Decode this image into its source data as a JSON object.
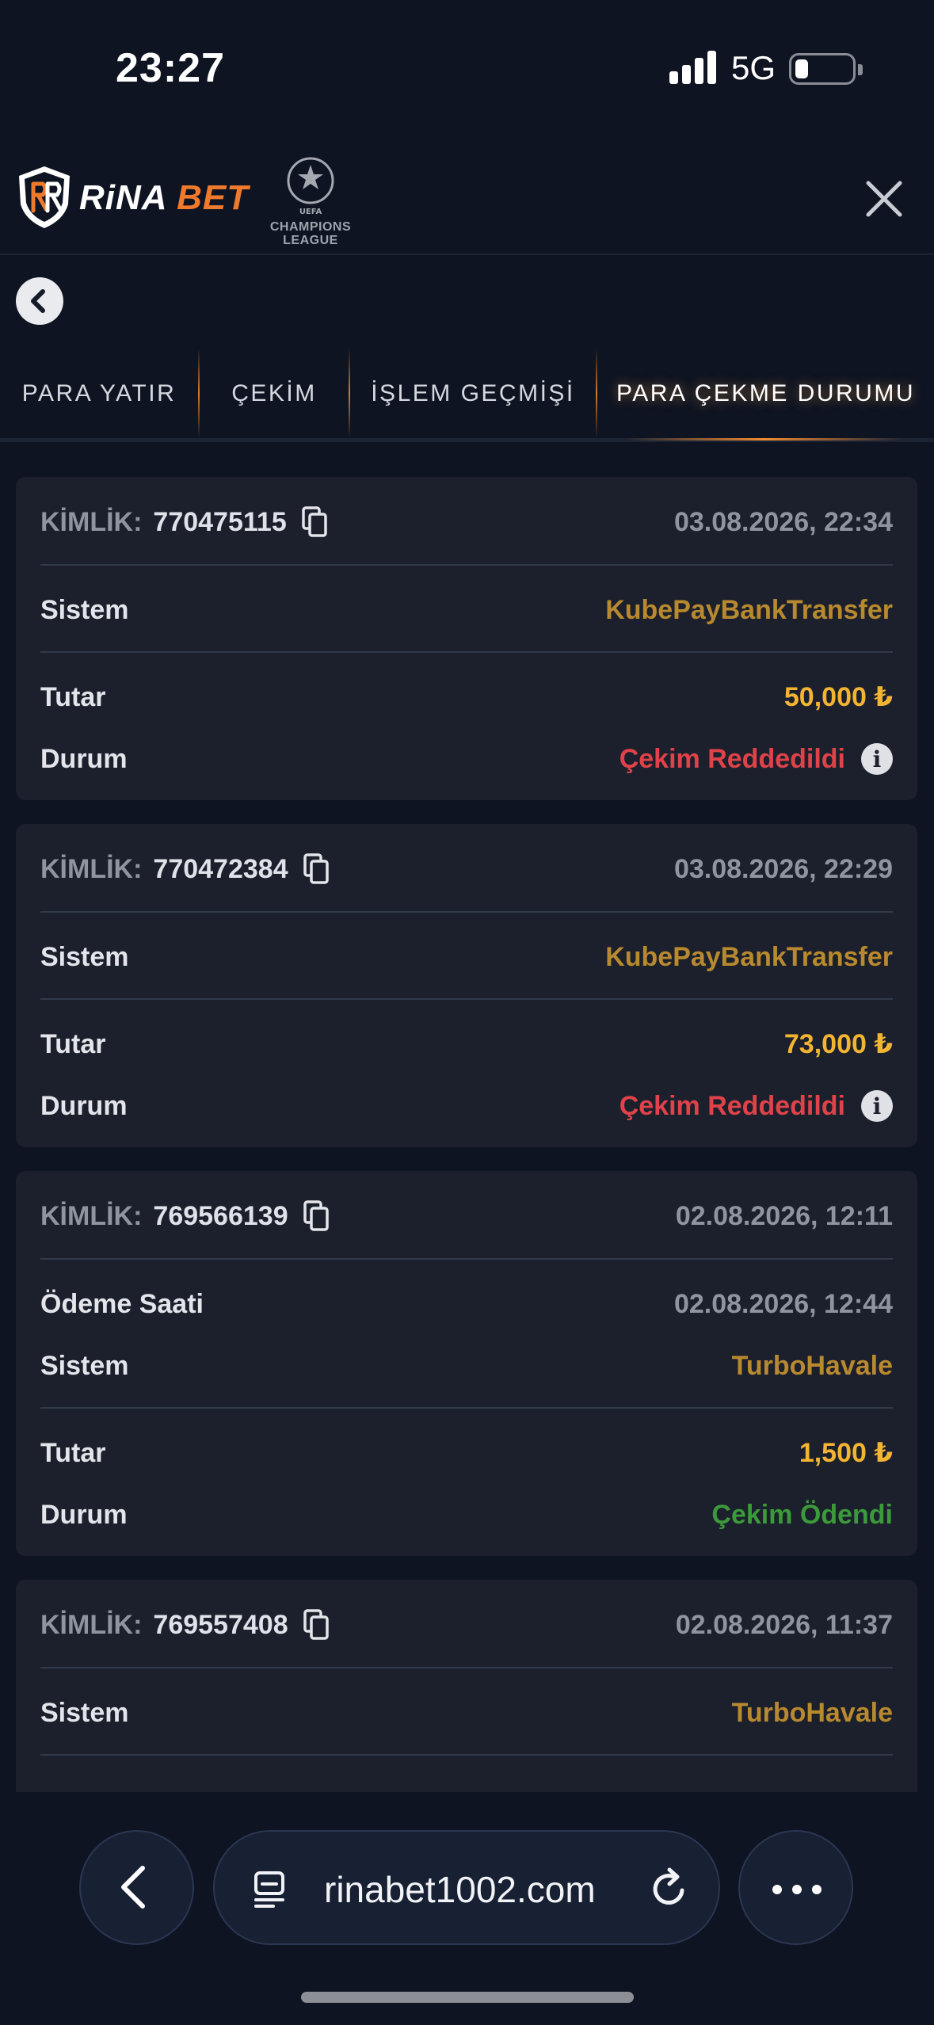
{
  "status_bar": {
    "time": "23:27",
    "network": "5G"
  },
  "header": {
    "brand_part1": "RiNA",
    "brand_part2": "BET",
    "partner_lines": [
      "CHAMPIONS",
      "LEAGUE"
    ]
  },
  "tabs": [
    {
      "label": "PARA YATIR"
    },
    {
      "label": "ÇEKİM"
    },
    {
      "label": "İŞLEM GEÇMİŞİ"
    },
    {
      "label": "PARA ÇEKME DURUMU",
      "active": true
    }
  ],
  "labels": {
    "kimlik": "KİMLİK:",
    "sistem": "Sistem",
    "tutar": "Tutar",
    "durum": "Durum",
    "odeme_saati": "Ödeme Saati"
  },
  "transactions": [
    {
      "id": "770475115",
      "date": "03.08.2026, 22:34",
      "system": "KubePayBankTransfer",
      "amount": "50,000 ₺",
      "status": "Çekim Reddedildi",
      "status_type": "rejected"
    },
    {
      "id": "770472384",
      "date": "03.08.2026, 22:29",
      "system": "KubePayBankTransfer",
      "amount": "73,000 ₺",
      "status": "Çekim Reddedildi",
      "status_type": "rejected"
    },
    {
      "id": "769566139",
      "date": "02.08.2026, 12:11",
      "payment_time": "02.08.2026, 12:44",
      "system": "TurboHavale",
      "amount": "1,500 ₺",
      "status": "Çekim Ödendi",
      "status_type": "paid"
    },
    {
      "id": "769557408",
      "date": "02.08.2026, 11:37",
      "system": "TurboHavale"
    }
  ],
  "browser": {
    "url": "rinabet1002.com"
  },
  "colors": {
    "background": "#0e1422",
    "card": "#1b202c",
    "accent_orange": "#f07a2c",
    "system_gold": "#b8892e",
    "amount_yellow": "#f2b431",
    "rejected_red": "#e0424a",
    "paid_green": "#3c9a3a"
  }
}
